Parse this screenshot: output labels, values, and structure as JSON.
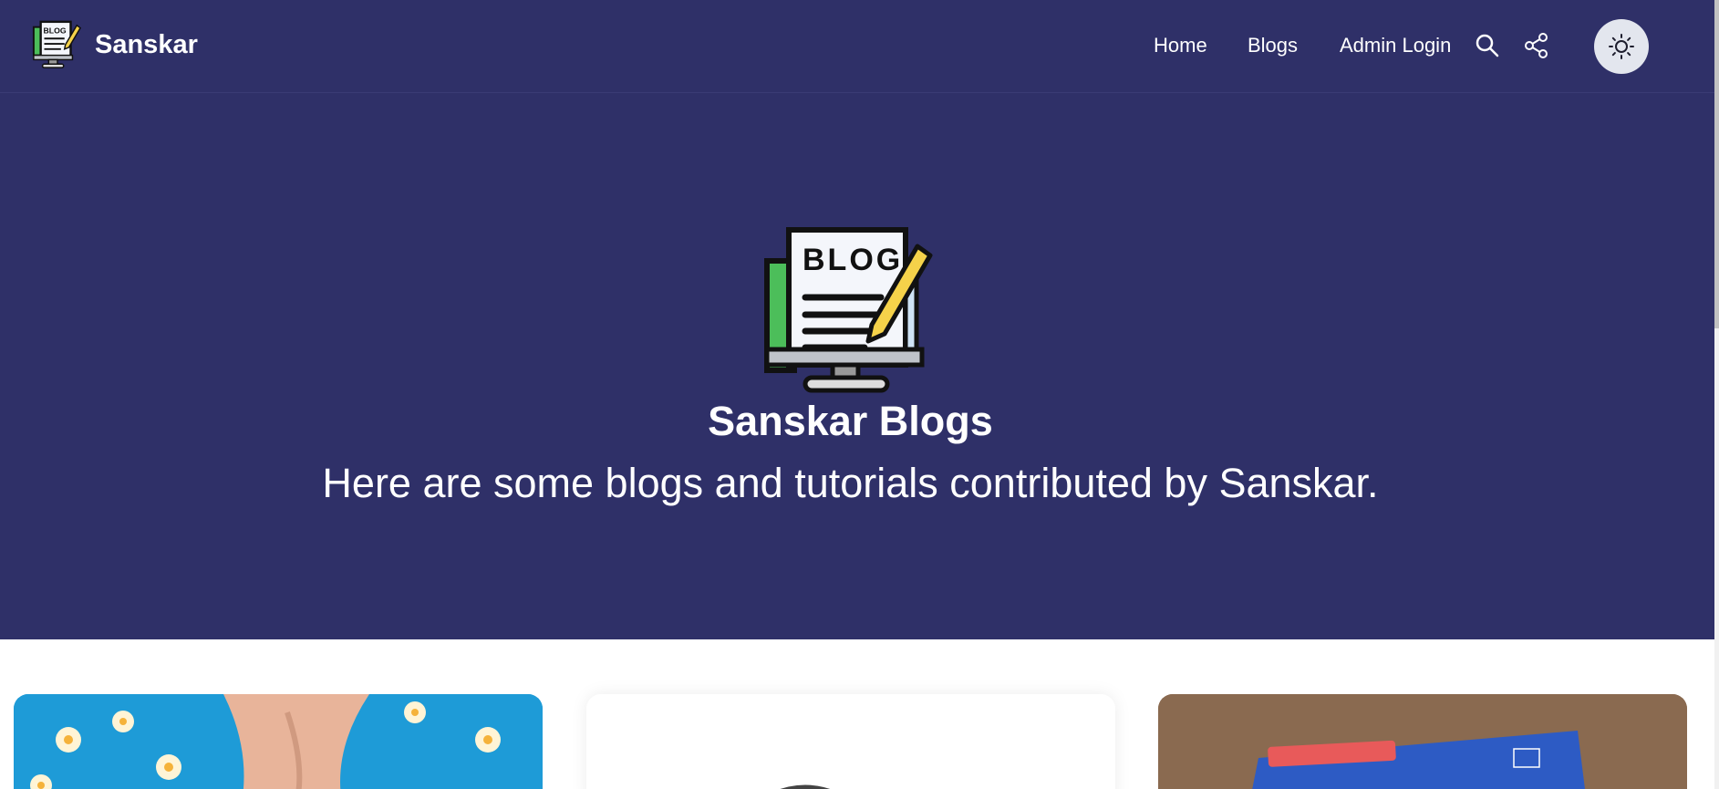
{
  "brand": {
    "name": "Sanskar",
    "logo_icon": "blog-monitor-icon",
    "logo_text": "BLOG"
  },
  "nav": {
    "links": [
      {
        "label": "Home"
      },
      {
        "label": "Blogs"
      },
      {
        "label": "Admin Login"
      }
    ],
    "icons": [
      "search-icon",
      "share-icon",
      "sun-icon"
    ]
  },
  "hero": {
    "logo_text": "BLOG",
    "title": "Sanskar Blogs",
    "subtitle": "Here are some blogs and tutorials contributed by Sanskar."
  },
  "cards": [
    {
      "image": "flowers-hands-photo"
    },
    {
      "image": "blank-white-photo"
    },
    {
      "image": "book-on-table-photo"
    }
  ],
  "colors": {
    "navbar_bg": "#2f3068",
    "hero_bg": "#2f3068",
    "toggle_bg": "#e3e6ee"
  }
}
